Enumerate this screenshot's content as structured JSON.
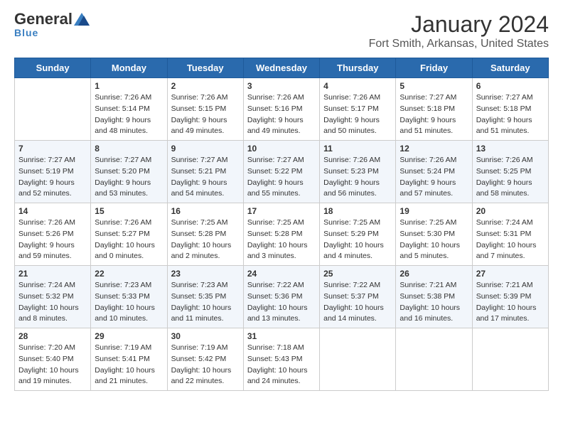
{
  "logo": {
    "general": "General",
    "blue": "Blue"
  },
  "title": "January 2024",
  "subtitle": "Fort Smith, Arkansas, United States",
  "headers": [
    "Sunday",
    "Monday",
    "Tuesday",
    "Wednesday",
    "Thursday",
    "Friday",
    "Saturday"
  ],
  "weeks": [
    [
      {
        "day": "",
        "sunrise": "",
        "sunset": "",
        "daylight": ""
      },
      {
        "day": "1",
        "sunrise": "Sunrise: 7:26 AM",
        "sunset": "Sunset: 5:14 PM",
        "daylight": "Daylight: 9 hours and 48 minutes."
      },
      {
        "day": "2",
        "sunrise": "Sunrise: 7:26 AM",
        "sunset": "Sunset: 5:15 PM",
        "daylight": "Daylight: 9 hours and 49 minutes."
      },
      {
        "day": "3",
        "sunrise": "Sunrise: 7:26 AM",
        "sunset": "Sunset: 5:16 PM",
        "daylight": "Daylight: 9 hours and 49 minutes."
      },
      {
        "day": "4",
        "sunrise": "Sunrise: 7:26 AM",
        "sunset": "Sunset: 5:17 PM",
        "daylight": "Daylight: 9 hours and 50 minutes."
      },
      {
        "day": "5",
        "sunrise": "Sunrise: 7:27 AM",
        "sunset": "Sunset: 5:18 PM",
        "daylight": "Daylight: 9 hours and 51 minutes."
      },
      {
        "day": "6",
        "sunrise": "Sunrise: 7:27 AM",
        "sunset": "Sunset: 5:18 PM",
        "daylight": "Daylight: 9 hours and 51 minutes."
      }
    ],
    [
      {
        "day": "7",
        "sunrise": "Sunrise: 7:27 AM",
        "sunset": "Sunset: 5:19 PM",
        "daylight": "Daylight: 9 hours and 52 minutes."
      },
      {
        "day": "8",
        "sunrise": "Sunrise: 7:27 AM",
        "sunset": "Sunset: 5:20 PM",
        "daylight": "Daylight: 9 hours and 53 minutes."
      },
      {
        "day": "9",
        "sunrise": "Sunrise: 7:27 AM",
        "sunset": "Sunset: 5:21 PM",
        "daylight": "Daylight: 9 hours and 54 minutes."
      },
      {
        "day": "10",
        "sunrise": "Sunrise: 7:27 AM",
        "sunset": "Sunset: 5:22 PM",
        "daylight": "Daylight: 9 hours and 55 minutes."
      },
      {
        "day": "11",
        "sunrise": "Sunrise: 7:26 AM",
        "sunset": "Sunset: 5:23 PM",
        "daylight": "Daylight: 9 hours and 56 minutes."
      },
      {
        "day": "12",
        "sunrise": "Sunrise: 7:26 AM",
        "sunset": "Sunset: 5:24 PM",
        "daylight": "Daylight: 9 hours and 57 minutes."
      },
      {
        "day": "13",
        "sunrise": "Sunrise: 7:26 AM",
        "sunset": "Sunset: 5:25 PM",
        "daylight": "Daylight: 9 hours and 58 minutes."
      }
    ],
    [
      {
        "day": "14",
        "sunrise": "Sunrise: 7:26 AM",
        "sunset": "Sunset: 5:26 PM",
        "daylight": "Daylight: 9 hours and 59 minutes."
      },
      {
        "day": "15",
        "sunrise": "Sunrise: 7:26 AM",
        "sunset": "Sunset: 5:27 PM",
        "daylight": "Daylight: 10 hours and 0 minutes."
      },
      {
        "day": "16",
        "sunrise": "Sunrise: 7:25 AM",
        "sunset": "Sunset: 5:28 PM",
        "daylight": "Daylight: 10 hours and 2 minutes."
      },
      {
        "day": "17",
        "sunrise": "Sunrise: 7:25 AM",
        "sunset": "Sunset: 5:28 PM",
        "daylight": "Daylight: 10 hours and 3 minutes."
      },
      {
        "day": "18",
        "sunrise": "Sunrise: 7:25 AM",
        "sunset": "Sunset: 5:29 PM",
        "daylight": "Daylight: 10 hours and 4 minutes."
      },
      {
        "day": "19",
        "sunrise": "Sunrise: 7:25 AM",
        "sunset": "Sunset: 5:30 PM",
        "daylight": "Daylight: 10 hours and 5 minutes."
      },
      {
        "day": "20",
        "sunrise": "Sunrise: 7:24 AM",
        "sunset": "Sunset: 5:31 PM",
        "daylight": "Daylight: 10 hours and 7 minutes."
      }
    ],
    [
      {
        "day": "21",
        "sunrise": "Sunrise: 7:24 AM",
        "sunset": "Sunset: 5:32 PM",
        "daylight": "Daylight: 10 hours and 8 minutes."
      },
      {
        "day": "22",
        "sunrise": "Sunrise: 7:23 AM",
        "sunset": "Sunset: 5:33 PM",
        "daylight": "Daylight: 10 hours and 10 minutes."
      },
      {
        "day": "23",
        "sunrise": "Sunrise: 7:23 AM",
        "sunset": "Sunset: 5:35 PM",
        "daylight": "Daylight: 10 hours and 11 minutes."
      },
      {
        "day": "24",
        "sunrise": "Sunrise: 7:22 AM",
        "sunset": "Sunset: 5:36 PM",
        "daylight": "Daylight: 10 hours and 13 minutes."
      },
      {
        "day": "25",
        "sunrise": "Sunrise: 7:22 AM",
        "sunset": "Sunset: 5:37 PM",
        "daylight": "Daylight: 10 hours and 14 minutes."
      },
      {
        "day": "26",
        "sunrise": "Sunrise: 7:21 AM",
        "sunset": "Sunset: 5:38 PM",
        "daylight": "Daylight: 10 hours and 16 minutes."
      },
      {
        "day": "27",
        "sunrise": "Sunrise: 7:21 AM",
        "sunset": "Sunset: 5:39 PM",
        "daylight": "Daylight: 10 hours and 17 minutes."
      }
    ],
    [
      {
        "day": "28",
        "sunrise": "Sunrise: 7:20 AM",
        "sunset": "Sunset: 5:40 PM",
        "daylight": "Daylight: 10 hours and 19 minutes."
      },
      {
        "day": "29",
        "sunrise": "Sunrise: 7:19 AM",
        "sunset": "Sunset: 5:41 PM",
        "daylight": "Daylight: 10 hours and 21 minutes."
      },
      {
        "day": "30",
        "sunrise": "Sunrise: 7:19 AM",
        "sunset": "Sunset: 5:42 PM",
        "daylight": "Daylight: 10 hours and 22 minutes."
      },
      {
        "day": "31",
        "sunrise": "Sunrise: 7:18 AM",
        "sunset": "Sunset: 5:43 PM",
        "daylight": "Daylight: 10 hours and 24 minutes."
      },
      {
        "day": "",
        "sunrise": "",
        "sunset": "",
        "daylight": ""
      },
      {
        "day": "",
        "sunrise": "",
        "sunset": "",
        "daylight": ""
      },
      {
        "day": "",
        "sunrise": "",
        "sunset": "",
        "daylight": ""
      }
    ]
  ]
}
